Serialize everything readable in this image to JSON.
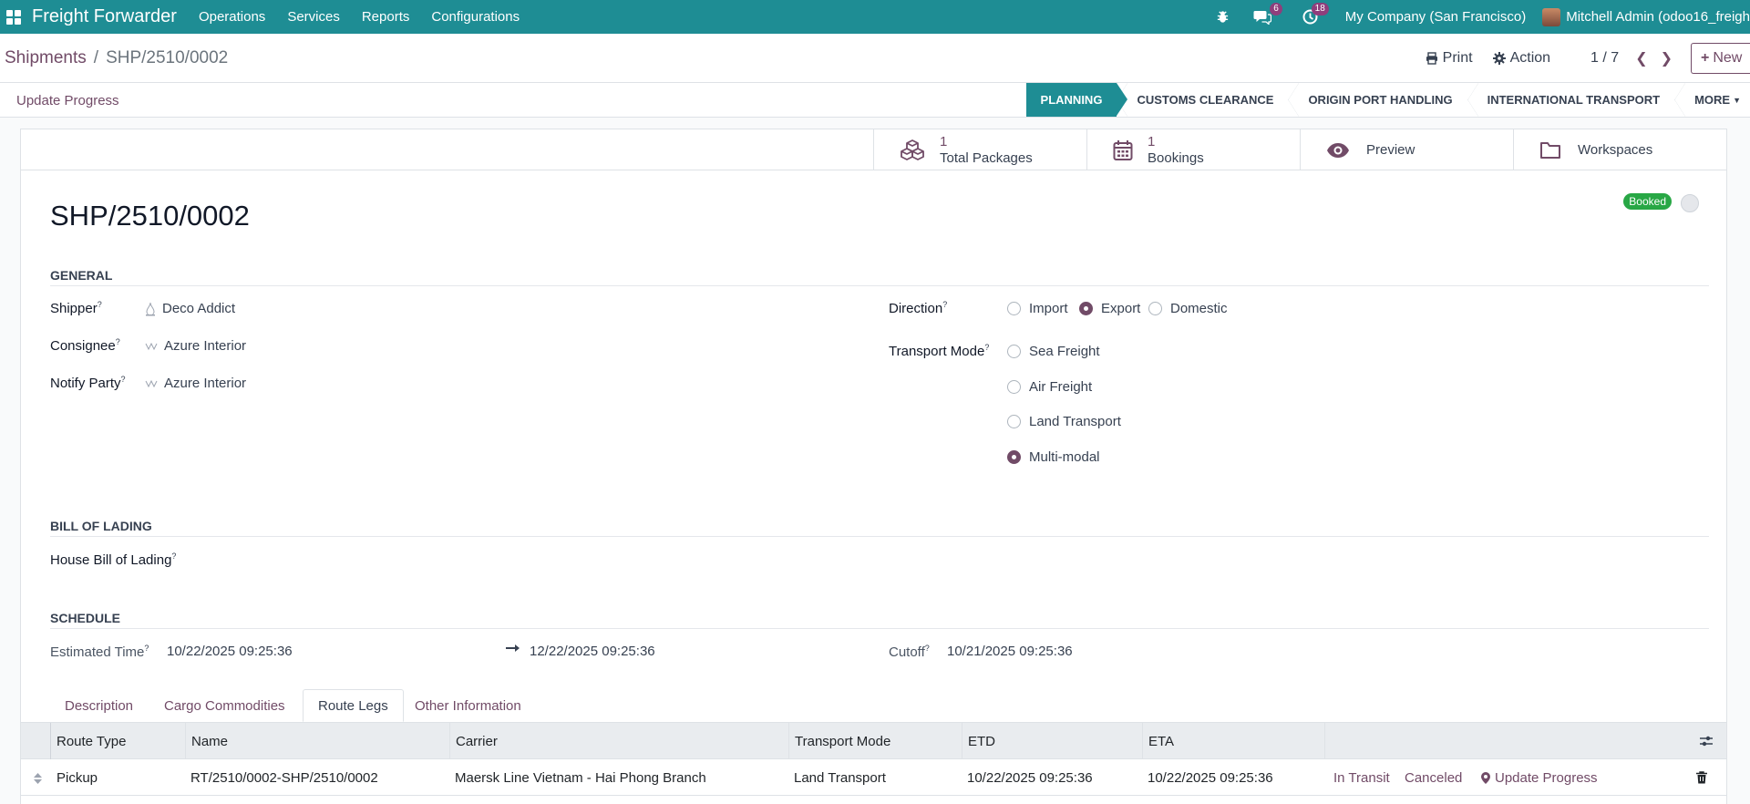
{
  "navbar": {
    "app_name": "Freight Forwarder",
    "menu": [
      "Operations",
      "Services",
      "Reports",
      "Configurations"
    ],
    "messages_count": "6",
    "activities_count": "18",
    "company": "My Company (San Francisco)",
    "user": "Mitchell Admin (odoo16_freigh"
  },
  "breadcrumb": {
    "parent": "Shipments",
    "separator": "/",
    "current": "SHP/2510/0002"
  },
  "control": {
    "print": "Print",
    "action": "Action",
    "pager": "1 / 7",
    "new": "New"
  },
  "statusbar": {
    "update_progress": "Update Progress",
    "stages": [
      "PLANNING",
      "CUSTOMS CLEARANCE",
      "ORIGIN PORT HANDLING",
      "INTERNATIONAL TRANSPORT"
    ],
    "active_stage": "PLANNING",
    "more": "MORE"
  },
  "smart_buttons": {
    "packages": {
      "value": "1",
      "label": "Total Packages"
    },
    "bookings": {
      "value": "1",
      "label": "Bookings"
    },
    "preview": "Preview",
    "workspaces": "Workspaces"
  },
  "record": {
    "name": "SHP/2510/0002",
    "ribbon": "Booked"
  },
  "general": {
    "section": "GENERAL",
    "shipper_label": "Shipper",
    "shipper": "Deco Addict",
    "consignee_label": "Consignee",
    "consignee": "Azure Interior",
    "notify_label": "Notify Party",
    "notify": "Azure Interior",
    "direction_label": "Direction",
    "directions": [
      "Import",
      "Export",
      "Domestic"
    ],
    "direction_selected": "Export",
    "transport_label": "Transport Mode",
    "transport_modes": [
      "Sea Freight",
      "Air Freight",
      "Land Transport",
      "Multi-modal"
    ],
    "transport_selected": "Multi-modal",
    "help_mark": "?"
  },
  "bol": {
    "section": "BILL OF LADING",
    "house_label": "House Bill of Lading"
  },
  "schedule": {
    "section": "SCHEDULE",
    "estimated_label": "Estimated Time",
    "start": "10/22/2025 09:25:36",
    "end": "12/22/2025 09:25:36",
    "cutoff_label": "Cutoff",
    "cutoff": "10/21/2025 09:25:36"
  },
  "tabs": [
    "Description",
    "Cargo Commodities",
    "Route Legs",
    "Other Information"
  ],
  "active_tab": "Route Legs",
  "route_legs": {
    "columns": [
      "Route Type",
      "Name",
      "Carrier",
      "Transport Mode",
      "ETD",
      "ETA"
    ],
    "rows": [
      {
        "route_type": "Pickup",
        "name": "RT/2510/0002-SHP/2510/0002",
        "carrier": "Maersk Line Vietnam - Hai Phong Branch",
        "transport_mode": "Land Transport",
        "etd": "10/22/2025 09:25:36",
        "eta": "10/22/2025 09:25:36",
        "action_in_transit": "In Transit",
        "action_canceled": "Canceled",
        "action_update": "Update Progress"
      }
    ]
  },
  "colors": {
    "navbar": "#1e8d94",
    "accent": "#714b67",
    "badge": "#8f3e7c",
    "ribbon": "#28a745"
  }
}
